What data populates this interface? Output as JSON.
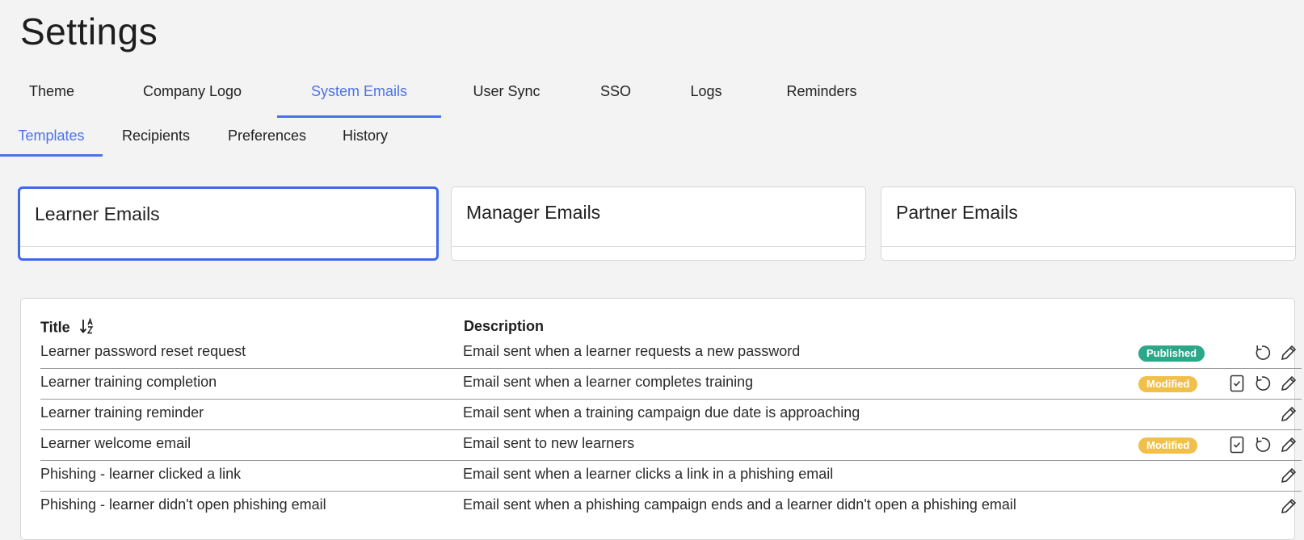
{
  "page": {
    "title": "Settings"
  },
  "tabs": [
    {
      "label": "Theme",
      "active": false
    },
    {
      "label": "Company Logo",
      "active": false
    },
    {
      "label": "System Emails",
      "active": true
    },
    {
      "label": "User Sync",
      "active": false
    },
    {
      "label": "SSO",
      "active": false
    },
    {
      "label": "Logs",
      "active": false
    },
    {
      "label": "Reminders",
      "active": false
    }
  ],
  "subtabs": [
    {
      "label": "Templates",
      "active": true
    },
    {
      "label": "Recipients",
      "active": false
    },
    {
      "label": "Preferences",
      "active": false
    },
    {
      "label": "History",
      "active": false
    }
  ],
  "cards": [
    {
      "label": "Learner Emails",
      "selected": true
    },
    {
      "label": "Manager Emails",
      "selected": false
    },
    {
      "label": "Partner Emails",
      "selected": false
    }
  ],
  "table": {
    "headers": {
      "title": "Title",
      "description": "Description"
    },
    "rows": [
      {
        "title": "Learner password reset request",
        "description": "Email sent when a learner requests a new password",
        "status": "Published",
        "actions": [
          "revert",
          "edit"
        ]
      },
      {
        "title": "Learner training completion",
        "description": "Email sent when a learner completes training",
        "status": "Modified",
        "actions": [
          "publish",
          "revert",
          "edit"
        ]
      },
      {
        "title": "Learner training reminder",
        "description": "Email sent when a training campaign due date is approaching",
        "status": "",
        "actions": [
          "edit"
        ]
      },
      {
        "title": "Learner welcome email",
        "description": "Email sent to new learners",
        "status": "Modified",
        "actions": [
          "publish",
          "revert",
          "edit"
        ]
      },
      {
        "title": "Phishing - learner clicked a link",
        "description": "Email sent when a learner clicks a link in a phishing email",
        "status": "",
        "actions": [
          "edit"
        ]
      },
      {
        "title": "Phishing - learner didn't open phishing email",
        "description": "Email sent when a phishing campaign ends and a learner didn't open a phishing email",
        "status": "",
        "actions": [
          "edit"
        ]
      }
    ]
  },
  "colors": {
    "accent": "#4b73e8",
    "published": "#2aa888",
    "modified": "#f1c04a",
    "background": "#f3f3f3"
  },
  "icons": {
    "sort": "sort-alpha-icon",
    "publish": "clipboard-check-icon",
    "revert": "revert-icon",
    "edit": "pencil-icon"
  }
}
